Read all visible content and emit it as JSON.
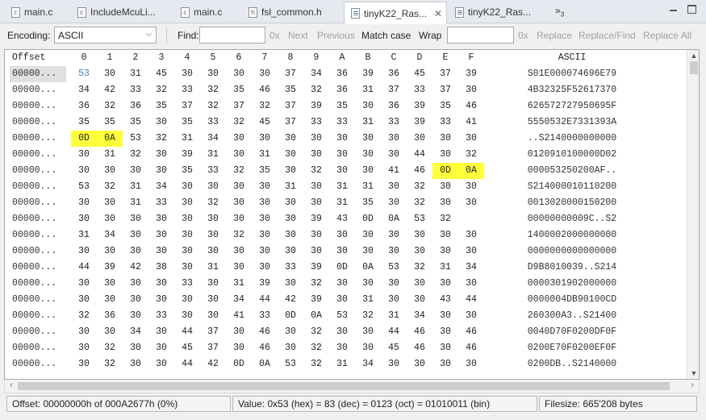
{
  "tabs": [
    {
      "label": "main.c",
      "icon": "c-file-icon",
      "active": false
    },
    {
      "label": "IncludeMcuLi...",
      "icon": "c-file-icon",
      "active": false
    },
    {
      "label": "main.c",
      "icon": "c-file-icon",
      "active": false
    },
    {
      "label": "fsl_common.h",
      "icon": "h-file-icon",
      "active": false
    },
    {
      "label": "tinyK22_Ras...",
      "icon": "hex-file-icon",
      "active": true
    },
    {
      "label": "tinyK22_Ras...",
      "icon": "hex-file-icon",
      "active": false
    }
  ],
  "overflow_label": "»",
  "overflow_count": "3",
  "toolbar": {
    "encoding_label": "Encoding:",
    "encoding_value": "ASCII",
    "find_label": "Find:",
    "find_value": "",
    "find_suffix": "0x",
    "next": "Next",
    "previous": "Previous",
    "match_case": "Match case",
    "wrap": "Wrap",
    "replace_value": "",
    "replace_suffix": "0x",
    "replace": "Replace",
    "replace_find": "Replace/Find",
    "replace_all": "Replace All"
  },
  "grid": {
    "offset_header": "Offset",
    "byte_headers": [
      "0",
      "1",
      "2",
      "3",
      "4",
      "5",
      "6",
      "7",
      "8",
      "9",
      "A",
      "B",
      "C",
      "D",
      "E",
      "F"
    ],
    "ascii_header": "ASCII",
    "rows": [
      {
        "offset": "00000...",
        "bytes": [
          "53",
          "30",
          "31",
          "45",
          "30",
          "30",
          "30",
          "30",
          "37",
          "34",
          "36",
          "39",
          "36",
          "45",
          "37",
          "39"
        ],
        "ascii": "S01E000074696E79"
      },
      {
        "offset": "00000...",
        "bytes": [
          "34",
          "42",
          "33",
          "32",
          "33",
          "32",
          "35",
          "46",
          "35",
          "32",
          "36",
          "31",
          "37",
          "33",
          "37",
          "30"
        ],
        "ascii": "4B32325F52617370"
      },
      {
        "offset": "00000...",
        "bytes": [
          "36",
          "32",
          "36",
          "35",
          "37",
          "32",
          "37",
          "32",
          "37",
          "39",
          "35",
          "30",
          "36",
          "39",
          "35",
          "46"
        ],
        "ascii": "626572727950695F"
      },
      {
        "offset": "00000...",
        "bytes": [
          "35",
          "35",
          "35",
          "30",
          "35",
          "33",
          "32",
          "45",
          "37",
          "33",
          "33",
          "31",
          "33",
          "39",
          "33",
          "41"
        ],
        "ascii": "5550532E7331393A"
      },
      {
        "offset": "00000...",
        "bytes": [
          "0D",
          "0A",
          "53",
          "32",
          "31",
          "34",
          "30",
          "30",
          "30",
          "30",
          "30",
          "30",
          "30",
          "30",
          "30",
          "30"
        ],
        "ascii": "..S2140000000000"
      },
      {
        "offset": "00000...",
        "bytes": [
          "30",
          "31",
          "32",
          "30",
          "39",
          "31",
          "30",
          "31",
          "30",
          "30",
          "30",
          "30",
          "30",
          "44",
          "30",
          "32"
        ],
        "ascii": "0120910100000D02"
      },
      {
        "offset": "00000...",
        "bytes": [
          "30",
          "30",
          "30",
          "30",
          "35",
          "33",
          "32",
          "35",
          "30",
          "32",
          "30",
          "30",
          "41",
          "46",
          "0D",
          "0A"
        ],
        "ascii": "000053250200AF.."
      },
      {
        "offset": "00000...",
        "bytes": [
          "53",
          "32",
          "31",
          "34",
          "30",
          "30",
          "30",
          "30",
          "31",
          "30",
          "31",
          "31",
          "30",
          "32",
          "30",
          "30"
        ],
        "ascii": "S214000010110200"
      },
      {
        "offset": "00000...",
        "bytes": [
          "30",
          "30",
          "31",
          "33",
          "30",
          "32",
          "30",
          "30",
          "30",
          "30",
          "31",
          "35",
          "30",
          "32",
          "30",
          "30"
        ],
        "ascii": "0013020000150200"
      },
      {
        "offset": "00000...",
        "bytes": [
          "30",
          "30",
          "30",
          "30",
          "30",
          "30",
          "30",
          "30",
          "30",
          "39",
          "43",
          "0D",
          "0A",
          "53",
          "32"
        ],
        "ascii": "00000000009C..S2"
      },
      {
        "offset": "00000...",
        "bytes": [
          "31",
          "34",
          "30",
          "30",
          "30",
          "30",
          "32",
          "30",
          "30",
          "30",
          "30",
          "30",
          "30",
          "30",
          "30",
          "30"
        ],
        "ascii": "1400002000000000"
      },
      {
        "offset": "00000...",
        "bytes": [
          "30",
          "30",
          "30",
          "30",
          "30",
          "30",
          "30",
          "30",
          "30",
          "30",
          "30",
          "30",
          "30",
          "30",
          "30",
          "30"
        ],
        "ascii": "0000000000000000"
      },
      {
        "offset": "00000...",
        "bytes": [
          "44",
          "39",
          "42",
          "38",
          "30",
          "31",
          "30",
          "30",
          "33",
          "39",
          "0D",
          "0A",
          "53",
          "32",
          "31",
          "34"
        ],
        "ascii": "D9B8010039..S214"
      },
      {
        "offset": "00000...",
        "bytes": [
          "30",
          "30",
          "30",
          "30",
          "33",
          "30",
          "31",
          "39",
          "30",
          "32",
          "30",
          "30",
          "30",
          "30",
          "30",
          "30"
        ],
        "ascii": "0000301902000000"
      },
      {
        "offset": "00000...",
        "bytes": [
          "30",
          "30",
          "30",
          "30",
          "30",
          "30",
          "34",
          "44",
          "42",
          "39",
          "30",
          "31",
          "30",
          "30",
          "43",
          "44"
        ],
        "ascii": "0000004DB90100CD"
      },
      {
        "offset": "00000...",
        "bytes": [
          "32",
          "36",
          "30",
          "33",
          "30",
          "30",
          "41",
          "33",
          "0D",
          "0A",
          "53",
          "32",
          "31",
          "34",
          "30",
          "30"
        ],
        "ascii": "260300A3..S21400"
      },
      {
        "offset": "00000...",
        "bytes": [
          "30",
          "30",
          "34",
          "30",
          "44",
          "37",
          "30",
          "46",
          "30",
          "32",
          "30",
          "30",
          "44",
          "46",
          "30",
          "46"
        ],
        "ascii": "0040D70F0200DF0F"
      },
      {
        "offset": "00000...",
        "bytes": [
          "30",
          "32",
          "30",
          "30",
          "45",
          "37",
          "30",
          "46",
          "30",
          "32",
          "30",
          "30",
          "45",
          "46",
          "30",
          "46"
        ],
        "ascii": "0200E70F0200EF0F"
      },
      {
        "offset": "00000...",
        "bytes": [
          "30",
          "32",
          "30",
          "30",
          "44",
          "42",
          "0D",
          "0A",
          "53",
          "32",
          "31",
          "34",
          "30",
          "30",
          "30",
          "30"
        ],
        "ascii": "0200DB..S2140000"
      }
    ],
    "highlighted": [
      [
        4,
        0
      ],
      [
        4,
        1
      ],
      [
        6,
        14
      ],
      [
        6,
        15
      ]
    ],
    "cursor": [
      0,
      0
    ]
  },
  "status": {
    "offset": "Offset: 00000000h of 000A2677h (0%)",
    "value": "Value: 0x53 (hex) = 83 (dec) = 0123 (oct) = 01010011 (bin)",
    "filesize": "Filesize: 665'208 bytes"
  },
  "colors": {
    "highlight": "#ffff3c",
    "cursor_text": "#3a7fc8"
  }
}
